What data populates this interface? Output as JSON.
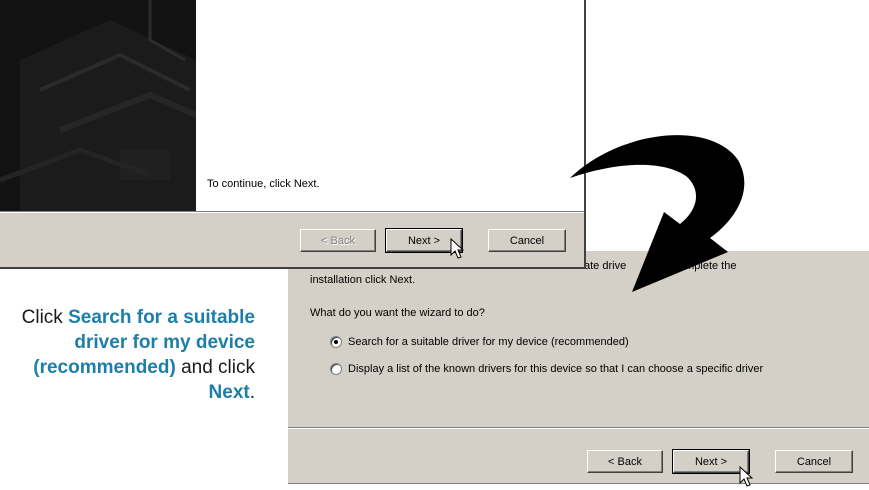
{
  "wizard_page1": {
    "continue_text": "To continue, click Next.",
    "buttons": {
      "back": "< Back",
      "next": "Next >",
      "cancel": "Cancel"
    }
  },
  "wizard_page2": {
    "intro_prefix": "ate drive",
    "intro_suffix": "nd complete the",
    "intro_line2": "installation click Next.",
    "question": "What do you want the wizard to do?",
    "options": [
      {
        "label": "Search for a suitable driver for my device (recommended)",
        "selected": true
      },
      {
        "label": "Display a list of the known drivers for this device so that I can choose a specific driver",
        "selected": false
      }
    ],
    "buttons": {
      "back": "< Back",
      "next": "Next >",
      "cancel": "Cancel"
    }
  },
  "instruction": {
    "part1": "Click ",
    "highlight1": "Search for a suitable driver for my device (recommended)",
    "part2": " and click ",
    "highlight2": "Next",
    "part3": "."
  },
  "colors": {
    "highlight": "#1d7fa8",
    "dialog_face": "#d4d0c8",
    "arrow": "#000000"
  },
  "icons": [
    "curved-arrow-icon",
    "mouse-pointer-icon"
  ]
}
